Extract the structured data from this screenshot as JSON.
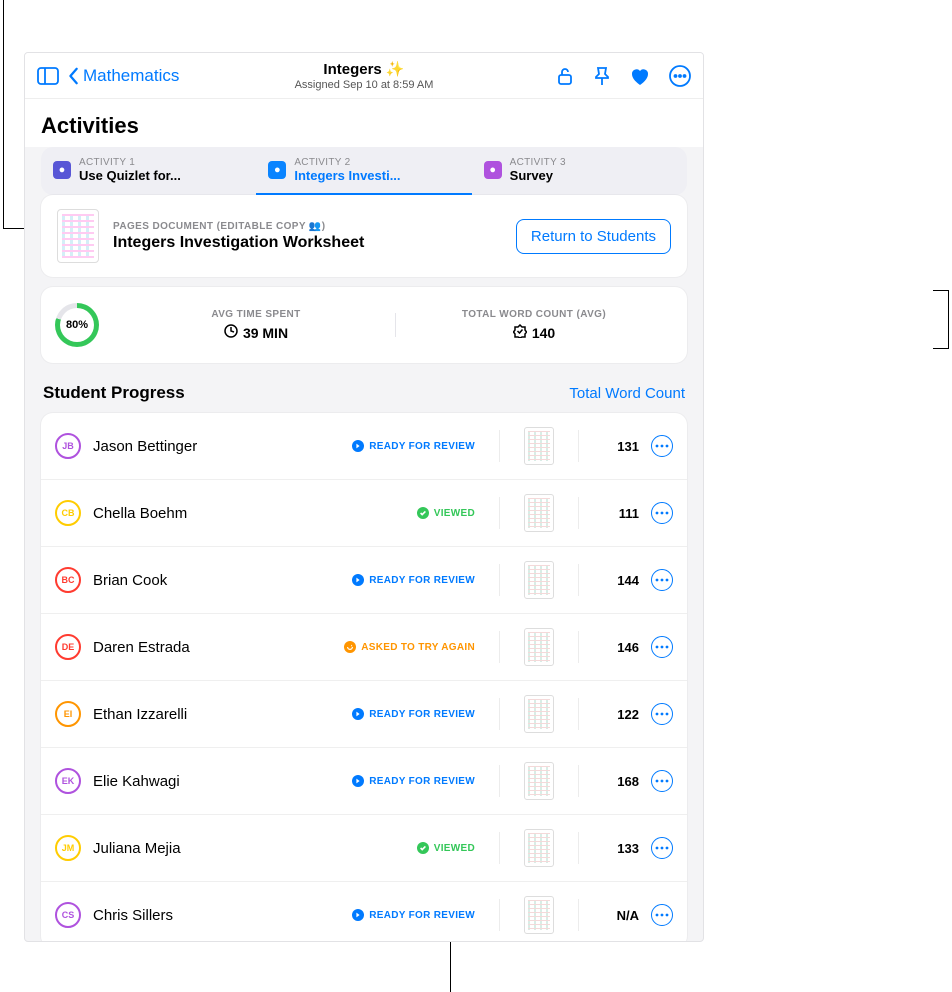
{
  "header": {
    "back_label": "Mathematics",
    "title": "Integers ✨",
    "subtitle": "Assigned Sep 10 at 8:59 AM"
  },
  "activities_heading": "Activities",
  "tabs": [
    {
      "label": "ACTIVITY 1",
      "name": "Use Quizlet for...",
      "icon_bg": "#5856d6",
      "active": false
    },
    {
      "label": "ACTIVITY 2",
      "name": "Integers Investi...",
      "icon_bg": "#0a84ff",
      "active": true
    },
    {
      "label": "ACTIVITY 3",
      "name": "Survey",
      "icon_bg": "#af52de",
      "active": false
    }
  ],
  "document": {
    "label": "PAGES DOCUMENT (EDITABLE COPY 👥)",
    "title": "Integers Investigation Worksheet",
    "button": "Return to Students"
  },
  "stats": {
    "progress_pct": "80%",
    "time_label": "AVG TIME SPENT",
    "time_value": "39 MIN",
    "count_label": "TOTAL WORD COUNT (AVG)",
    "count_value": "140"
  },
  "student_progress": {
    "title": "Student Progress",
    "link": "Total Word Count"
  },
  "status_styles": {
    "ready": {
      "text": "READY FOR REVIEW",
      "color": "#007aff",
      "glyph": "arrow"
    },
    "viewed": {
      "text": "VIEWED",
      "color": "#34c759",
      "glyph": "check"
    },
    "tryagain": {
      "text": "ASKED TO TRY AGAIN",
      "color": "#ff9500",
      "glyph": "redo"
    }
  },
  "students": [
    {
      "initials": "JB",
      "ring": "#af52de",
      "name": "Jason Bettinger",
      "status": "ready",
      "count": "131"
    },
    {
      "initials": "CB",
      "ring": "#ffcc00",
      "name": "Chella Boehm",
      "status": "viewed",
      "count": "111"
    },
    {
      "initials": "BC",
      "ring": "#ff3b30",
      "name": "Brian Cook",
      "status": "ready",
      "count": "144"
    },
    {
      "initials": "DE",
      "ring": "#ff3b30",
      "name": "Daren Estrada",
      "status": "tryagain",
      "count": "146"
    },
    {
      "initials": "EI",
      "ring": "#ff9500",
      "name": "Ethan Izzarelli",
      "status": "ready",
      "count": "122"
    },
    {
      "initials": "EK",
      "ring": "#af52de",
      "name": "Elie Kahwagi",
      "status": "ready",
      "count": "168"
    },
    {
      "initials": "JM",
      "ring": "#ffcc00",
      "name": "Juliana Mejia",
      "status": "viewed",
      "count": "133"
    },
    {
      "initials": "CS",
      "ring": "#af52de",
      "name": "Chris Sillers",
      "status": "ready",
      "count": "N/A"
    }
  ]
}
